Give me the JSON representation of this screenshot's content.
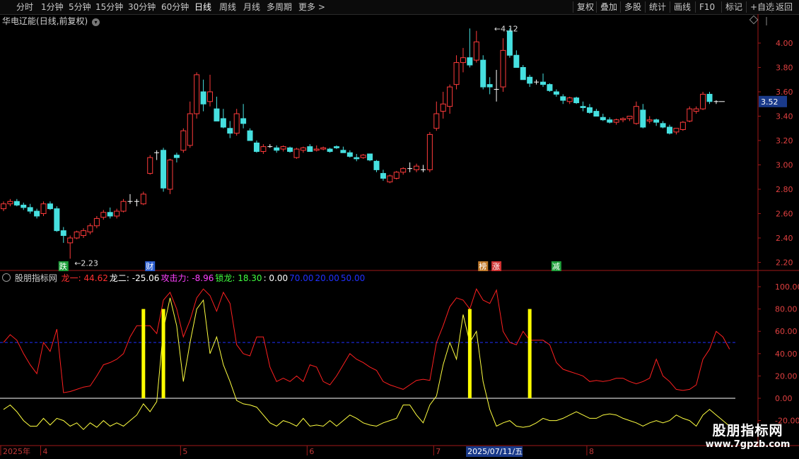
{
  "toolbar": {
    "periods": [
      "分时",
      "1分钟",
      "5分钟",
      "15分钟",
      "30分钟",
      "60分钟",
      "日线",
      "周线",
      "月线",
      "多周期",
      "更多"
    ],
    "active_period": "日线",
    "more_icon": "chevron-right-icon",
    "actions": [
      "复权",
      "叠加",
      "多股",
      "统计",
      "画线",
      "F10",
      "标记",
      "+自选",
      "返回"
    ]
  },
  "stock": {
    "name": "华电辽能",
    "mode": "(日线,前复权)",
    "menu_icon": "chevron-down-circle-icon",
    "last_price": "3.52",
    "high_label": "4.12",
    "low_label": "2.23"
  },
  "signals": [
    {
      "label": "跌",
      "bar": 9,
      "color": "#1e9e3a"
    },
    {
      "label": "财",
      "bar": 22,
      "color": "#2c5fd0"
    },
    {
      "label": "榜",
      "bar": 72,
      "color": "#c07a2a"
    },
    {
      "label": "涨",
      "bar": 74,
      "color": "#d03030"
    },
    {
      "label": "减",
      "bar": 83,
      "color": "#1e9e3a"
    }
  ],
  "indicator": {
    "name": "股朋指标网",
    "items": [
      {
        "text": "龙一: 44.62",
        "color": "#ff3030"
      },
      {
        "text": "龙二: -25.06",
        "color": "#ffffff"
      },
      {
        "text": "攻击力: -8.96",
        "color": "#ff40ff"
      },
      {
        "text": "锁龙: 18.30",
        "color": "#40ff40"
      },
      {
        "text": ": 0.00",
        "color": "#ffffff"
      },
      {
        "text": "70.00",
        "color": "#2030ff"
      },
      {
        "text": "20.00",
        "color": "#2030ff"
      },
      {
        "text": "50.00",
        "color": "#2030ff"
      }
    ]
  },
  "xaxis": {
    "labels": [
      {
        "text": "2025年",
        "bar": 0
      },
      {
        "text": "4",
        "bar": 6
      },
      {
        "text": "5",
        "bar": 27
      },
      {
        "text": "6",
        "bar": 46
      },
      {
        "text": "7",
        "bar": 65
      },
      {
        "text": "8",
        "bar": 88
      }
    ],
    "highlight": "2025/07/11/五",
    "highlight_bar": 74
  },
  "watermark": {
    "title": "股朋指标网",
    "url": "www.7gpzb.com"
  },
  "colors": {
    "up": "#ff3b3b",
    "down": "#46e0e0",
    "flat": "#ffffff",
    "long1": "#ff2020",
    "long2": "#ffff40",
    "bar": "#ffff00",
    "dash": "#2030ff",
    "axis": "#a01818"
  },
  "chart_data": [
    {
      "type": "candlestick",
      "title": "华电辽能(日线,前复权)",
      "ylim": [
        2.15,
        4.2
      ],
      "yticks": [
        2.2,
        2.4,
        2.6,
        2.8,
        3.0,
        3.2,
        3.4,
        3.6,
        3.8,
        4.0
      ],
      "last_value": 3.52,
      "ohlc": [
        [
          2.64,
          2.7,
          2.62,
          2.68
        ],
        [
          2.68,
          2.72,
          2.66,
          2.7
        ],
        [
          2.7,
          2.72,
          2.66,
          2.67
        ],
        [
          2.67,
          2.69,
          2.63,
          2.65
        ],
        [
          2.65,
          2.68,
          2.6,
          2.62
        ],
        [
          2.62,
          2.64,
          2.56,
          2.58
        ],
        [
          2.6,
          2.7,
          2.58,
          2.68
        ],
        [
          2.68,
          2.7,
          2.63,
          2.64
        ],
        [
          2.64,
          2.66,
          2.45,
          2.46
        ],
        [
          2.46,
          2.49,
          2.36,
          2.42
        ],
        [
          2.36,
          2.42,
          2.23,
          2.4
        ],
        [
          2.4,
          2.46,
          2.39,
          2.45
        ],
        [
          2.42,
          2.48,
          2.4,
          2.46
        ],
        [
          2.45,
          2.52,
          2.43,
          2.5
        ],
        [
          2.5,
          2.58,
          2.48,
          2.56
        ],
        [
          2.57,
          2.63,
          2.55,
          2.61
        ],
        [
          2.61,
          2.65,
          2.56,
          2.58
        ],
        [
          2.58,
          2.64,
          2.56,
          2.62
        ],
        [
          2.62,
          2.72,
          2.61,
          2.7
        ],
        [
          2.7,
          2.76,
          2.68,
          2.7
        ],
        [
          2.7,
          2.72,
          2.66,
          2.7
        ],
        [
          2.68,
          2.78,
          2.67,
          2.76
        ],
        [
          2.93,
          3.08,
          2.92,
          3.06
        ],
        [
          3.1,
          3.12,
          3.04,
          3.1
        ],
        [
          3.12,
          3.14,
          2.78,
          2.81
        ],
        [
          2.8,
          3.05,
          2.76,
          3.04
        ],
        [
          3.08,
          3.1,
          3.02,
          3.06
        ],
        [
          3.12,
          3.3,
          3.1,
          3.28
        ],
        [
          3.16,
          3.52,
          3.14,
          3.42
        ],
        [
          3.42,
          3.76,
          3.38,
          3.74
        ],
        [
          3.6,
          3.7,
          3.44,
          3.5
        ],
        [
          3.52,
          3.74,
          3.48,
          3.6
        ],
        [
          3.46,
          3.56,
          3.36,
          3.36
        ],
        [
          3.38,
          3.46,
          3.3,
          3.31
        ],
        [
          3.3,
          3.36,
          3.22,
          3.26
        ],
        [
          3.26,
          3.46,
          3.24,
          3.42
        ],
        [
          3.38,
          3.5,
          3.3,
          3.34
        ],
        [
          3.28,
          3.3,
          3.2,
          3.2
        ],
        [
          3.18,
          3.2,
          3.1,
          3.11
        ],
        [
          3.11,
          3.17,
          3.09,
          3.15
        ],
        [
          3.15,
          3.17,
          3.14,
          3.15
        ],
        [
          3.14,
          3.16,
          3.1,
          3.12
        ],
        [
          3.13,
          3.16,
          3.11,
          3.15
        ],
        [
          3.14,
          3.15,
          3.1,
          3.11
        ],
        [
          3.06,
          3.14,
          3.05,
          3.13
        ],
        [
          3.12,
          3.15,
          3.1,
          3.14
        ],
        [
          3.15,
          3.17,
          3.11,
          3.11
        ],
        [
          3.12,
          3.16,
          3.11,
          3.13
        ],
        [
          3.13,
          3.15,
          3.12,
          3.14
        ],
        [
          3.13,
          3.14,
          3.1,
          3.11
        ],
        [
          3.15,
          3.16,
          3.13,
          3.14
        ],
        [
          3.12,
          3.15,
          3.1,
          3.1
        ],
        [
          3.1,
          3.12,
          3.06,
          3.07
        ],
        [
          3.06,
          3.09,
          3.03,
          3.05
        ],
        [
          3.06,
          3.09,
          3.05,
          3.08
        ],
        [
          3.09,
          3.09,
          3.03,
          3.04
        ],
        [
          3.03,
          3.04,
          2.94,
          2.96
        ],
        [
          2.93,
          2.96,
          2.87,
          2.89
        ],
        [
          2.86,
          2.92,
          2.85,
          2.91
        ],
        [
          2.89,
          2.95,
          2.88,
          2.94
        ],
        [
          2.94,
          2.98,
          2.92,
          2.97
        ],
        [
          2.97,
          3.02,
          2.94,
          2.97
        ],
        [
          2.96,
          3.01,
          2.94,
          2.99
        ],
        [
          2.96,
          3.0,
          2.94,
          2.96
        ],
        [
          2.96,
          3.27,
          2.94,
          3.25
        ],
        [
          3.3,
          3.52,
          3.28,
          3.42
        ],
        [
          3.44,
          3.6,
          3.38,
          3.5
        ],
        [
          3.48,
          3.66,
          3.42,
          3.64
        ],
        [
          3.66,
          3.9,
          3.62,
          3.84
        ],
        [
          3.84,
          3.96,
          3.76,
          3.88
        ],
        [
          3.88,
          4.12,
          3.8,
          3.82
        ],
        [
          3.86,
          4.1,
          3.84,
          4.01
        ],
        [
          3.86,
          3.9,
          3.62,
          3.64
        ],
        [
          3.66,
          3.72,
          3.58,
          3.64
        ],
        [
          3.62,
          3.78,
          3.52,
          3.62
        ],
        [
          3.64,
          4.04,
          3.6,
          3.94
        ],
        [
          4.1,
          4.12,
          3.88,
          3.9
        ],
        [
          3.9,
          3.94,
          3.8,
          3.8
        ],
        [
          3.8,
          3.82,
          3.7,
          3.7
        ],
        [
          3.72,
          3.74,
          3.64,
          3.67
        ],
        [
          3.68,
          3.7,
          3.66,
          3.68
        ],
        [
          3.68,
          3.75,
          3.64,
          3.66
        ],
        [
          3.66,
          3.67,
          3.6,
          3.61
        ],
        [
          3.6,
          3.62,
          3.56,
          3.58
        ],
        [
          3.56,
          3.58,
          3.5,
          3.53
        ],
        [
          3.52,
          3.56,
          3.5,
          3.55
        ],
        [
          3.55,
          3.56,
          3.5,
          3.51
        ],
        [
          3.48,
          3.52,
          3.44,
          3.47
        ],
        [
          3.47,
          3.5,
          3.42,
          3.43
        ],
        [
          3.44,
          3.46,
          3.4,
          3.4
        ],
        [
          3.39,
          3.42,
          3.36,
          3.37
        ],
        [
          3.37,
          3.39,
          3.34,
          3.35
        ],
        [
          3.35,
          3.38,
          3.33,
          3.37
        ],
        [
          3.37,
          3.39,
          3.35,
          3.38
        ],
        [
          3.38,
          3.4,
          3.36,
          3.4
        ],
        [
          3.34,
          3.52,
          3.33,
          3.48
        ],
        [
          3.45,
          3.5,
          3.3,
          3.31
        ],
        [
          3.36,
          3.4,
          3.34,
          3.37
        ],
        [
          3.37,
          3.38,
          3.32,
          3.35
        ],
        [
          3.34,
          3.36,
          3.3,
          3.31
        ],
        [
          3.31,
          3.33,
          3.25,
          3.26
        ],
        [
          3.27,
          3.3,
          3.25,
          3.3
        ],
        [
          3.29,
          3.36,
          3.28,
          3.35
        ],
        [
          3.36,
          3.48,
          3.35,
          3.46
        ],
        [
          3.44,
          3.48,
          3.42,
          3.46
        ],
        [
          3.46,
          3.6,
          3.45,
          3.58
        ],
        [
          3.58,
          3.6,
          3.5,
          3.52
        ],
        [
          3.52,
          3.53,
          3.5,
          3.52
        ]
      ]
    },
    {
      "type": "line",
      "title": "股朋指标网",
      "ylim": [
        -28,
        106
      ],
      "yticks": [
        -20,
        0,
        20,
        40,
        60,
        80,
        100
      ],
      "reference_lines": {
        "solid": 0,
        "dashed": 50
      },
      "series": [
        {
          "name": "龙一",
          "color": "#ff2020",
          "values": [
            50,
            57,
            52,
            40,
            30,
            22,
            50,
            42,
            62,
            5,
            6,
            8,
            10,
            11,
            20,
            30,
            32,
            35,
            40,
            55,
            65,
            65,
            65,
            58,
            88,
            95,
            80,
            55,
            70,
            90,
            98,
            92,
            78,
            95,
            85,
            48,
            40,
            38,
            55,
            55,
            28,
            15,
            18,
            15,
            20,
            15,
            30,
            28,
            15,
            12,
            20,
            30,
            40,
            35,
            32,
            28,
            25,
            15,
            12,
            10,
            8,
            12,
            16,
            17,
            16,
            50,
            65,
            82,
            90,
            88,
            80,
            98,
            88,
            85,
            97,
            60,
            50,
            48,
            60,
            52,
            52,
            52,
            48,
            32,
            26,
            24,
            22,
            20,
            15,
            16,
            15,
            16,
            18,
            18,
            15,
            13,
            15,
            18,
            35,
            20,
            15,
            8,
            7,
            8,
            12,
            35,
            44,
            60,
            55,
            44
          ]
        },
        {
          "name": "龙二",
          "color": "#ffff40",
          "values": [
            -10,
            -6,
            -12,
            -20,
            -25,
            -25,
            -18,
            -24,
            -18,
            -20,
            -25,
            -22,
            -28,
            -22,
            -26,
            -20,
            -25,
            -22,
            -25,
            -20,
            -15,
            -5,
            -12,
            -3,
            62,
            90,
            65,
            15,
            50,
            80,
            88,
            40,
            55,
            30,
            15,
            -2,
            -5,
            -6,
            -8,
            -15,
            -22,
            -25,
            -20,
            -22,
            -25,
            -18,
            -25,
            -24,
            -25,
            -20,
            -25,
            -20,
            -15,
            -18,
            -22,
            -24,
            -25,
            -22,
            -20,
            -18,
            -6,
            -6,
            -15,
            -22,
            -6,
            2,
            30,
            50,
            35,
            75,
            50,
            60,
            15,
            -10,
            -25,
            -22,
            -20,
            -25,
            -26,
            -25,
            -22,
            -18,
            -20,
            -20,
            -18,
            -15,
            -12,
            -15,
            -18,
            -18,
            -15,
            -14,
            -15,
            -18,
            -20,
            -22,
            -25,
            -22,
            -20,
            -22,
            -20,
            -15,
            -18,
            -20,
            -25,
            -15,
            -10,
            -15,
            -20,
            -25
          ]
        },
        {
          "name": "攻击力",
          "color": "#ffff00",
          "type": "bar",
          "bars": [
            {
              "bar": 21,
              "top": 80
            },
            {
              "bar": 24,
              "top": 80
            },
            {
              "bar": 70,
              "top": 80
            },
            {
              "bar": 79,
              "top": 80
            }
          ]
        }
      ]
    }
  ]
}
